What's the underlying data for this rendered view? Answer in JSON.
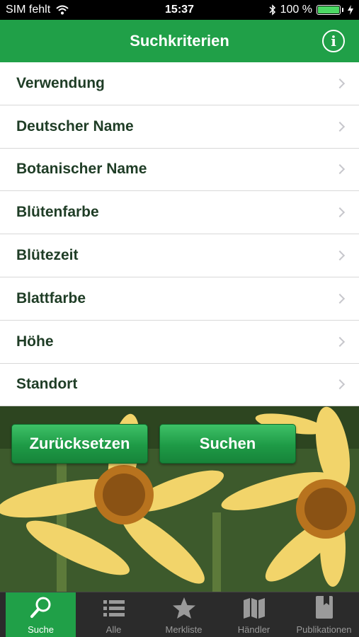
{
  "status_bar": {
    "carrier": "SIM fehlt",
    "time": "15:37",
    "battery": "100 %",
    "battery_level": 1.0
  },
  "nav": {
    "title": "Suchkriterien",
    "info_icon": "info-icon"
  },
  "criteria": [
    {
      "label": "Verwendung"
    },
    {
      "label": "Deutscher Name"
    },
    {
      "label": "Botanischer Name"
    },
    {
      "label": "Blütenfarbe"
    },
    {
      "label": "Blütezeit"
    },
    {
      "label": "Blattfarbe"
    },
    {
      "label": "Höhe"
    },
    {
      "label": "Standort"
    }
  ],
  "actions": {
    "reset_label": "Zurücksetzen",
    "search_label": "Suchen"
  },
  "tabs": [
    {
      "label": "Suche",
      "icon": "search-icon",
      "active": true
    },
    {
      "label": "Alle",
      "icon": "list-icon",
      "active": false
    },
    {
      "label": "Merkliste",
      "icon": "star-icon",
      "active": false
    },
    {
      "label": "Händler",
      "icon": "map-icon",
      "active": false
    },
    {
      "label": "Publikationen",
      "icon": "book-icon",
      "active": false
    }
  ],
  "colors": {
    "accent": "#20a048",
    "tab_bar": "#2b2b2b",
    "label_text": "#1f3d26"
  }
}
